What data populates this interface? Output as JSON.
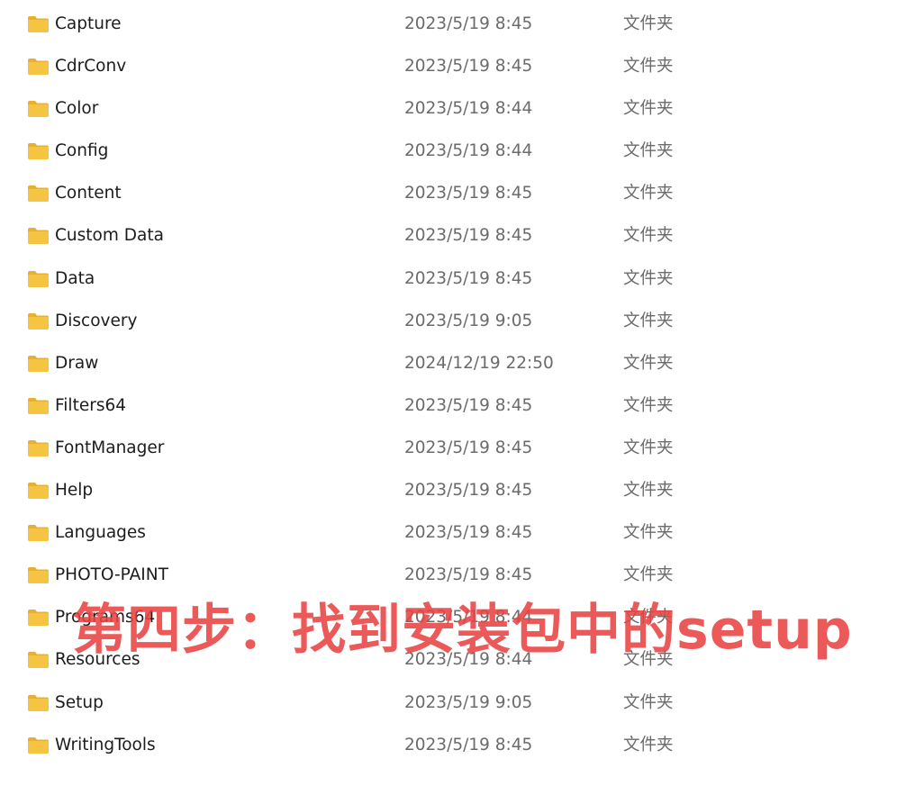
{
  "file_list": {
    "rows": [
      {
        "name": "Capture",
        "modified": "2023/5/19 8:45",
        "type": "文件夹",
        "icon": "folder-icon"
      },
      {
        "name": "CdrConv",
        "modified": "2023/5/19 8:45",
        "type": "文件夹",
        "icon": "folder-icon"
      },
      {
        "name": "Color",
        "modified": "2023/5/19 8:44",
        "type": "文件夹",
        "icon": "folder-icon"
      },
      {
        "name": "Config",
        "modified": "2023/5/19 8:44",
        "type": "文件夹",
        "icon": "folder-icon"
      },
      {
        "name": "Content",
        "modified": "2023/5/19 8:45",
        "type": "文件夹",
        "icon": "folder-icon"
      },
      {
        "name": "Custom Data",
        "modified": "2023/5/19 8:45",
        "type": "文件夹",
        "icon": "folder-icon"
      },
      {
        "name": "Data",
        "modified": "2023/5/19 8:45",
        "type": "文件夹",
        "icon": "folder-icon"
      },
      {
        "name": "Discovery",
        "modified": "2023/5/19 9:05",
        "type": "文件夹",
        "icon": "folder-icon"
      },
      {
        "name": "Draw",
        "modified": "2024/12/19 22:50",
        "type": "文件夹",
        "icon": "folder-icon"
      },
      {
        "name": "Filters64",
        "modified": "2023/5/19 8:45",
        "type": "文件夹",
        "icon": "folder-icon"
      },
      {
        "name": "FontManager",
        "modified": "2023/5/19 8:45",
        "type": "文件夹",
        "icon": "folder-icon"
      },
      {
        "name": "Help",
        "modified": "2023/5/19 8:45",
        "type": "文件夹",
        "icon": "folder-icon"
      },
      {
        "name": "Languages",
        "modified": "2023/5/19 8:45",
        "type": "文件夹",
        "icon": "folder-icon"
      },
      {
        "name": "PHOTO-PAINT",
        "modified": "2023/5/19 8:45",
        "type": "文件夹",
        "icon": "folder-icon"
      },
      {
        "name": "Programs64",
        "modified": "2023/5/19 8:44",
        "type": "文件夹",
        "icon": "folder-icon"
      },
      {
        "name": "Resources",
        "modified": "2023/5/19 8:44",
        "type": "文件夹",
        "icon": "folder-icon"
      },
      {
        "name": "Setup",
        "modified": "2023/5/19 9:05",
        "type": "文件夹",
        "icon": "folder-icon"
      },
      {
        "name": "WritingTools",
        "modified": "2023/5/19 8:45",
        "type": "文件夹",
        "icon": "folder-icon"
      }
    ]
  },
  "overlay": {
    "caption": "第四步：找到安装包中的setup",
    "color": "#e84242"
  },
  "colors": {
    "folder_fill": "#f6c443",
    "folder_tab": "#e9b02f",
    "name_text": "#1c1c1c",
    "meta_text": "#6b6b6b"
  }
}
